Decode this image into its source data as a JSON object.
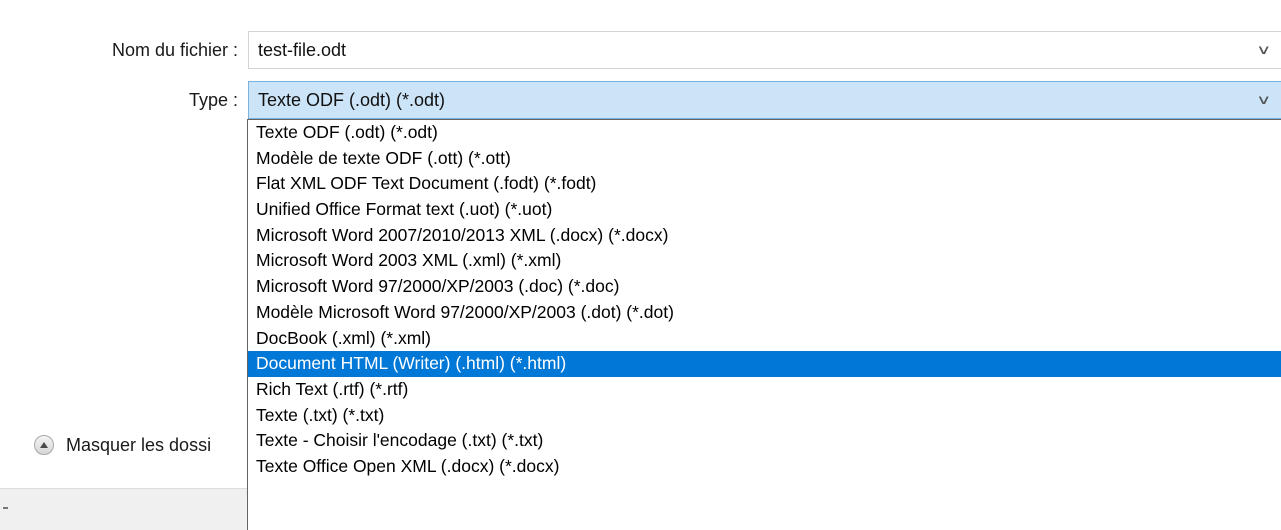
{
  "form": {
    "filename_label": "Nom du fichier :",
    "filename_value": "test-file.odt",
    "type_label": "Type :",
    "type_value": "Texte ODF (.odt) (*.odt)"
  },
  "type_options": [
    "Texte ODF (.odt) (*.odt)",
    "Modèle de texte ODF (.ott) (*.ott)",
    "Flat XML ODF Text Document (.fodt) (*.fodt)",
    "Unified Office Format text (.uot) (*.uot)",
    "Microsoft Word 2007/2010/2013 XML (.docx) (*.docx)",
    "Microsoft Word 2003 XML (.xml) (*.xml)",
    "Microsoft Word 97/2000/XP/2003 (.doc) (*.doc)",
    "Modèle Microsoft Word 97/2000/XP/2003 (.dot) (*.dot)",
    "DocBook (.xml) (*.xml)",
    "Document HTML (Writer) (.html) (*.html)",
    "Rich Text (.rtf) (*.rtf)",
    "Texte (.txt) (*.txt)",
    "Texte - Choisir l'encodage (.txt) (*.txt)",
    "Texte Office Open XML (.docx) (*.docx)"
  ],
  "highlighted_option": "Document HTML (Writer) (.html) (*.html)",
  "folders_toggle": {
    "label": "Masquer les dossi",
    "icon": "chevron-up-circle-icon"
  },
  "colors": {
    "selection": "#0078d7",
    "type_field_bg": "#cce4f7",
    "type_field_border": "#7ab1dd"
  }
}
